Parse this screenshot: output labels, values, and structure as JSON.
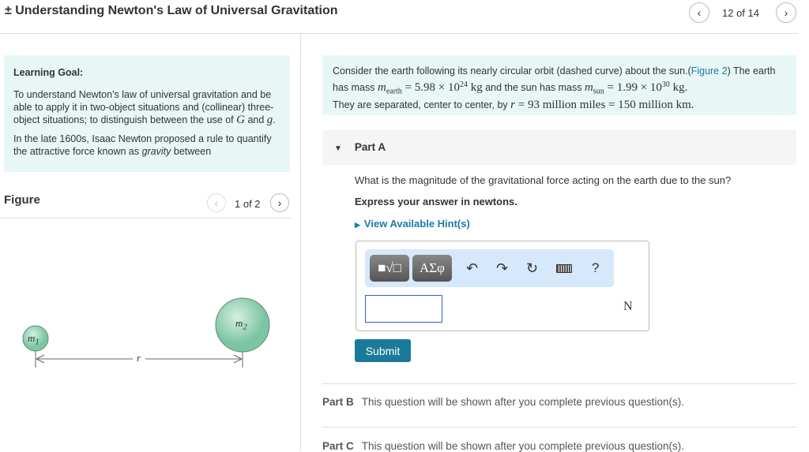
{
  "header": {
    "title": "± Understanding Newton's Law of Universal Gravitation",
    "page": "12 of 14"
  },
  "goal": {
    "heading": "Learning Goal:",
    "p1a": "To understand Newton's law of universal gravitation and be able to apply it in two-object situations and (collinear) three-object situations; to distinguish between the use of ",
    "G": "G",
    "and": " and ",
    "g": "g",
    "dot": ".",
    "p2a": "In the late 1600s, Isaac Newton proposed a rule to quantify the attractive force known as ",
    "gravity": "gravity",
    "p2b": " between"
  },
  "figure": {
    "label": "Figure",
    "page": "1 of 2",
    "m1": "m",
    "m1sub": "1",
    "m2": "m",
    "m2sub": "2",
    "r": "r"
  },
  "desc": {
    "t1": "Consider the earth following its nearly circular orbit (dashed curve) about the sun.(",
    "link": "Figure 2",
    "t2": ") The earth has mass ",
    "m_earth": "m",
    "earth_sub": "earth",
    "eq1": " = 5.98 × 10",
    "exp1": "24",
    "kg1": " kg",
    "t3": " and the sun has mass ",
    "m_sun": "m",
    "sun_sub": "sun",
    "eq2": " = 1.99 × 10",
    "exp2": "30",
    "kg2": " kg.",
    "t4": "They are separated, center to center, by ",
    "r": "r",
    "eq3": " = 93 million miles = 150 million km."
  },
  "partA": {
    "label": "Part A",
    "question": "What is the magnitude of the gravitational force acting on the earth due to the sun?",
    "instruction": "Express your answer in newtons.",
    "hints": "View Available Hint(s)",
    "toolbar": {
      "templates": "■√□",
      "greek": "ΑΣφ",
      "help": "?"
    },
    "answer": "",
    "unit": "N",
    "submit": "Submit"
  },
  "partB": {
    "label": "Part B",
    "text": "This question will be shown after you complete previous question(s)."
  },
  "partC": {
    "label": "Part C",
    "text": "This question will be shown after you complete previous question(s)."
  }
}
